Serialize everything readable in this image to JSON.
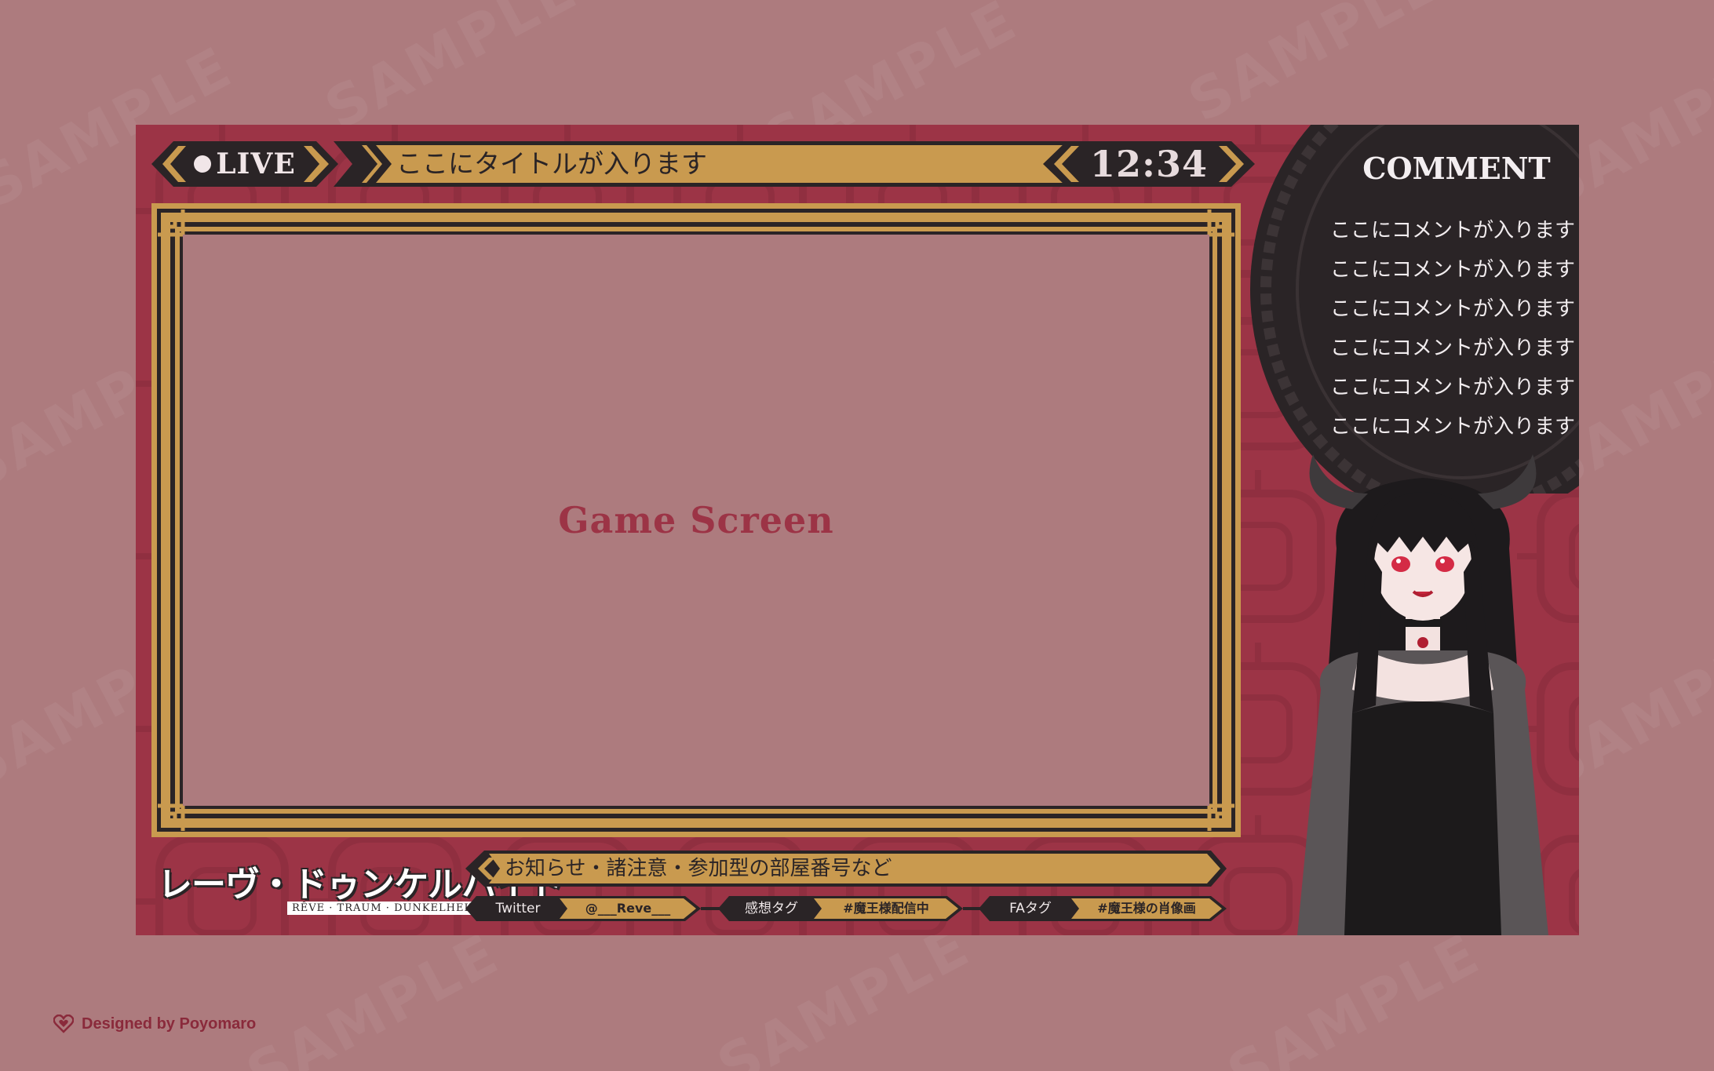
{
  "overlay": {
    "live_label": "LIVE",
    "title": "ここにタイトルが入ります",
    "time": "12:34",
    "game_label": "Game Screen",
    "comment_heading": "COMMENT",
    "comments": [
      "ここにコメントが入ります",
      "ここにコメントが入ります",
      "ここにコメントが入ります",
      "ここにコメントが入ります",
      "ここにコメントが入ります",
      "ここにコメントが入ります"
    ],
    "logo_main": "レーヴ・ドゥンケルハイト",
    "logo_sub": "RÊVE · TRAUM · DUNKELHEIT",
    "notice": "お知らせ・諸注意・参加型の部屋番号など",
    "tags": [
      {
        "label": "Twitter",
        "value": "@___Reve___"
      },
      {
        "label": "感想タグ",
        "value": "#魔王様配信中"
      },
      {
        "label": "FAタグ",
        "value": "#魔王様の肖像画"
      }
    ]
  },
  "watermark": "SAMPLE",
  "credit": "Designed by Poyomaro",
  "colors": {
    "background": "#ad7b7e",
    "panel": "#9c3446",
    "gold": "#c99a4f",
    "dark": "#2a2426"
  }
}
